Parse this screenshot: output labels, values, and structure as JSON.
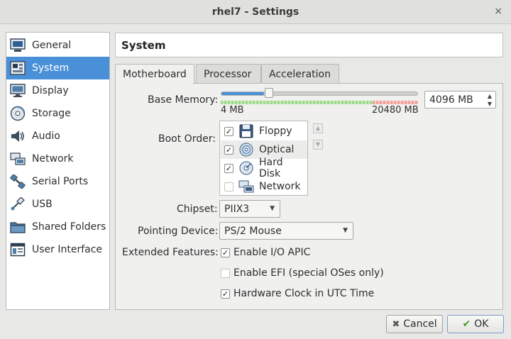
{
  "window": {
    "title": "rhel7 - Settings",
    "close_glyph": "×"
  },
  "sidebar": {
    "items": [
      {
        "label": "General",
        "icon": "general-icon"
      },
      {
        "label": "System",
        "icon": "motherboard-icon",
        "active": true
      },
      {
        "label": "Display",
        "icon": "monitor-icon"
      },
      {
        "label": "Storage",
        "icon": "storage-icon"
      },
      {
        "label": "Audio",
        "icon": "speaker-icon"
      },
      {
        "label": "Network",
        "icon": "network-icon"
      },
      {
        "label": "Serial Ports",
        "icon": "serial-port-icon"
      },
      {
        "label": "USB",
        "icon": "usb-icon"
      },
      {
        "label": "Shared Folders",
        "icon": "folder-icon"
      },
      {
        "label": "User Interface",
        "icon": "user-interface-icon"
      }
    ]
  },
  "section_title": "System",
  "tabs": [
    {
      "label": "Motherboard",
      "active": true
    },
    {
      "label": "Processor"
    },
    {
      "label": "Acceleration"
    }
  ],
  "motherboard": {
    "base_memory": {
      "label": "Base Memory:",
      "min_label": "4 MB",
      "max_label": "20480 MB",
      "value": "4096 MB",
      "value_mb": 4096,
      "min_mb": 4,
      "max_mb": 20480
    },
    "boot_order": {
      "label": "Boot Order:",
      "items": [
        {
          "label": "Floppy",
          "checked": true,
          "icon": "floppy-icon"
        },
        {
          "label": "Optical",
          "checked": true,
          "icon": "optical-disc-icon",
          "selected": true
        },
        {
          "label": "Hard Disk",
          "checked": true,
          "icon": "hard-disk-icon"
        },
        {
          "label": "Network",
          "checked": false,
          "icon": "network-boot-icon"
        }
      ]
    },
    "chipset": {
      "label": "Chipset:",
      "value": "PIIX3"
    },
    "pointing_device": {
      "label": "Pointing Device:",
      "value": "PS/2 Mouse"
    },
    "extended_features": {
      "label": "Extended Features:",
      "options": [
        {
          "label": "Enable I/O APIC",
          "checked": true
        },
        {
          "label": "Enable EFI (special OSes only)",
          "checked": false
        },
        {
          "label": "Hardware Clock in UTC Time",
          "checked": true
        }
      ]
    }
  },
  "buttons": {
    "cancel": "Cancel",
    "ok": "OK"
  },
  "colors": {
    "accent": "#4a90d9",
    "safe_zone": "#9fd98c",
    "danger_zone": "#f2a19a"
  }
}
